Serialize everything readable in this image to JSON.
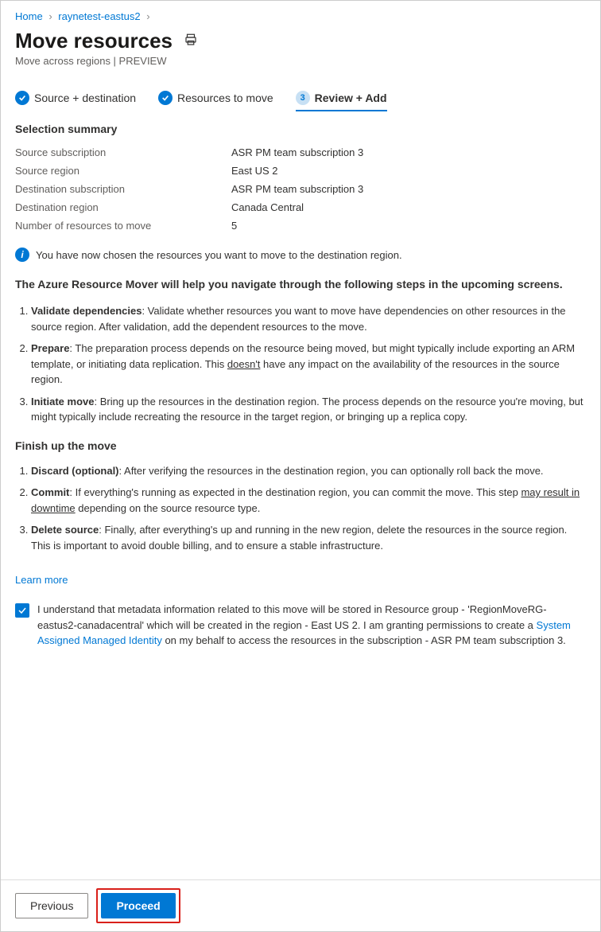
{
  "breadcrumb": {
    "home": "Home",
    "resource": "raynetest-eastus2"
  },
  "header": {
    "title": "Move resources",
    "subtitle": "Move across regions | PREVIEW"
  },
  "tabs": {
    "t1": "Source + destination",
    "t2": "Resources to move",
    "t3_num": "3",
    "t3": "Review + Add"
  },
  "summary": {
    "heading": "Selection summary",
    "rows": {
      "src_sub_k": "Source subscription",
      "src_sub_v": "ASR PM team subscription 3",
      "src_reg_k": "Source region",
      "src_reg_v": "East US 2",
      "dst_sub_k": "Destination subscription",
      "dst_sub_v": "ASR PM team subscription 3",
      "dst_reg_k": "Destination region",
      "dst_reg_v": "Canada Central",
      "count_k": "Number of resources to move",
      "count_v": "5"
    }
  },
  "info_text": "You have now chosen the resources you want to move to the destination region.",
  "intro": "The Azure Resource Mover will help you navigate through the following steps in the upcoming screens.",
  "steps1": {
    "s1_name": "Validate dependencies",
    "s1_body": ": Validate whether resources you want to move have dependencies on other resources in the source region. After validation, add the dependent resources to the move.",
    "s2_name": "Prepare",
    "s2_body_a": ": The preparation process depends on the resource being moved, but might typically include exporting an ARM template, or initiating data replication. This ",
    "s2_body_u": "doesn't",
    "s2_body_b": " have any impact on the availability of the resources in the source region.",
    "s3_name": "Initiate move",
    "s3_body": ": Bring up the resources in the destination region. The process depends on the resource you're moving, but might typically include recreating the resource in the target region, or bringing up a replica copy."
  },
  "finish_heading": "Finish up the move",
  "steps2": {
    "s1_name": "Discard (optional)",
    "s1_body": ": After verifying the resources in the destination region, you can optionally roll back the move.",
    "s2_name": "Commit",
    "s2_body_a": ": If everything's running as expected in the destination region, you can commit the move. This step ",
    "s2_body_u": "may result in downtime",
    "s2_body_b": " depending on the source resource type.",
    "s3_name": "Delete source",
    "s3_body": ": Finally, after everything's up and running in the new region, delete the resources in the source region. This is important to avoid double billing, and to ensure a stable infrastructure."
  },
  "learn_more": "Learn more",
  "consent": {
    "text_a": "I understand that metadata information related to this move will be stored in Resource group - 'RegionMoveRG-eastus2-canadacentral' which will be created in the region - East US 2. I am granting permissions to create a ",
    "link": "System Assigned Managed Identity",
    "text_b": " on my behalf to access the resources in the subscription - ASR PM team subscription 3."
  },
  "footer": {
    "previous": "Previous",
    "proceed": "Proceed"
  }
}
